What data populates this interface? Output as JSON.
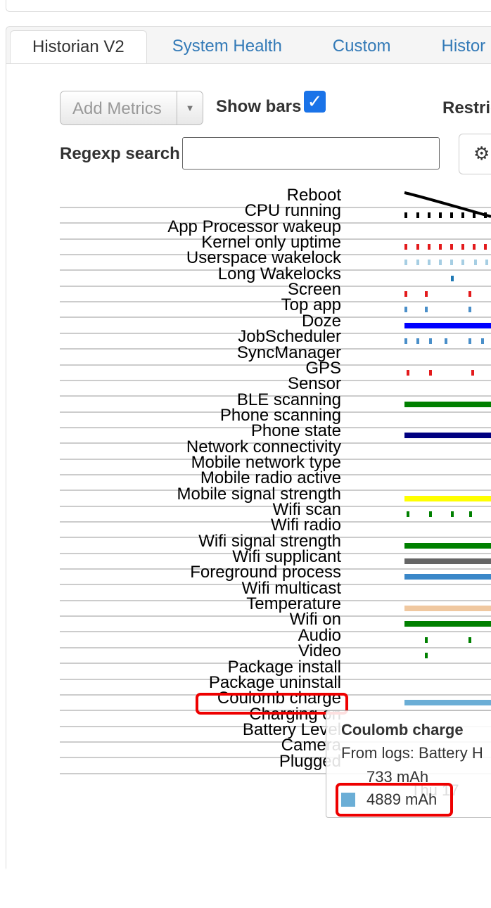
{
  "tabs": [
    "Historian V2",
    "System Health",
    "Custom",
    "Histor"
  ],
  "controls": {
    "add_metrics": "Add Metrics",
    "show_bars": "Show bars",
    "show_bars_checked": true,
    "restrict": "Restric",
    "regexp_label": "Regexp search",
    "regexp_value": ""
  },
  "rows": [
    {
      "label": "Reboot",
      "color": "#000000"
    },
    {
      "label": "CPU running",
      "color": "#000000"
    },
    {
      "label": "App Processor wakeup",
      "color": ""
    },
    {
      "label": "Kernel only uptime",
      "color": "#e31a1c"
    },
    {
      "label": "Userspace wakelock",
      "color": "#a6cee3"
    },
    {
      "label": "Long Wakelocks",
      "color": "#1f78b4"
    },
    {
      "label": "Screen",
      "color": "#e31a1c"
    },
    {
      "label": "Top app",
      "color": "#4a8fc9"
    },
    {
      "label": "Doze",
      "color": "#0000ff"
    },
    {
      "label": "JobScheduler",
      "color": "#4a8fc9"
    },
    {
      "label": "SyncManager",
      "color": ""
    },
    {
      "label": "GPS",
      "color": "#e31a1c"
    },
    {
      "label": "Sensor",
      "color": ""
    },
    {
      "label": "BLE scanning",
      "color": "#008000"
    },
    {
      "label": "Phone scanning",
      "color": ""
    },
    {
      "label": "Phone state",
      "color": "#000080"
    },
    {
      "label": "Network connectivity",
      "color": ""
    },
    {
      "label": "Mobile network type",
      "color": ""
    },
    {
      "label": "Mobile radio active",
      "color": ""
    },
    {
      "label": "Mobile signal strength",
      "color": "#ffff00"
    },
    {
      "label": "Wifi scan",
      "color": "#008000"
    },
    {
      "label": "Wifi radio",
      "color": ""
    },
    {
      "label": "Wifi signal strength",
      "color": "#008000"
    },
    {
      "label": "Wifi supplicant",
      "color": "#666666"
    },
    {
      "label": "Foreground process",
      "color": "#3a87c8"
    },
    {
      "label": "Wifi multicast",
      "color": ""
    },
    {
      "label": "Temperature",
      "color": "#f0c8a0"
    },
    {
      "label": "Wifi on",
      "color": "#008000"
    },
    {
      "label": "Audio",
      "color": "#008000"
    },
    {
      "label": "Video",
      "color": "#008000"
    },
    {
      "label": "Package install",
      "color": ""
    },
    {
      "label": "Package uninstall",
      "color": ""
    },
    {
      "label": "Coulomb charge",
      "color": "#6baed6"
    },
    {
      "label": "Charging on",
      "color": ""
    },
    {
      "label": "Battery Level",
      "color": ""
    },
    {
      "label": "Camera",
      "color": ""
    },
    {
      "label": "Plugged",
      "color": ""
    }
  ],
  "tooltip": {
    "title": "Coulomb charge",
    "source": "From logs: Battery H",
    "value1": "733 mAh",
    "value2": "4889 mAh",
    "swatch_color": "#6baed6",
    "bg_axis_label": "Thu 17"
  },
  "highlight_color": "#ee0000"
}
